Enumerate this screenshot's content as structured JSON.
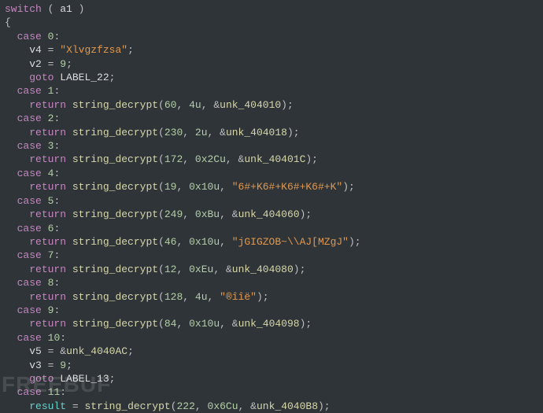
{
  "code": {
    "switch_kw": "switch",
    "switch_var": "a1",
    "case0": {
      "label": "case",
      "num": "0",
      "v4": "v4",
      "v4_val": "\"Xlvgzfzsa\"",
      "v2": "v2",
      "v2_val": "9",
      "goto_kw": "goto",
      "goto_target": "LABEL_22"
    },
    "case1": {
      "label": "case",
      "num": "1",
      "ret": "return",
      "fn": "string_decrypt",
      "a": "60",
      "b": "4u",
      "amp": "&",
      "c": "unk_404010"
    },
    "case2": {
      "label": "case",
      "num": "2",
      "ret": "return",
      "fn": "string_decrypt",
      "a": "230",
      "b": "2u",
      "amp": "&",
      "c": "unk_404018"
    },
    "case3": {
      "label": "case",
      "num": "3",
      "ret": "return",
      "fn": "string_decrypt",
      "a": "172",
      "b": "0x2Cu",
      "amp": "&",
      "c": "unk_40401C"
    },
    "case4": {
      "label": "case",
      "num": "4",
      "ret": "return",
      "fn": "string_decrypt",
      "a": "19",
      "b": "0x10u",
      "c": "\"6#+K6#+K6#+K6#+K\""
    },
    "case5": {
      "label": "case",
      "num": "5",
      "ret": "return",
      "fn": "string_decrypt",
      "a": "249",
      "b": "0xBu",
      "amp": "&",
      "c": "unk_404060"
    },
    "case6": {
      "label": "case",
      "num": "6",
      "ret": "return",
      "fn": "string_decrypt",
      "a": "46",
      "b": "0x10u",
      "c": "\"jGIGZOB~\\\\AJ[MZgJ\""
    },
    "case7": {
      "label": "case",
      "num": "7",
      "ret": "return",
      "fn": "string_decrypt",
      "a": "12",
      "b": "0xEu",
      "amp": "&",
      "c": "unk_404080"
    },
    "case8": {
      "label": "case",
      "num": "8",
      "ret": "return",
      "fn": "string_decrypt",
      "a": "128",
      "b": "4u",
      "c": "\"®îîë\""
    },
    "case9": {
      "label": "case",
      "num": "9",
      "ret": "return",
      "fn": "string_decrypt",
      "a": "84",
      "b": "0x10u",
      "amp": "&",
      "c": "unk_404098"
    },
    "case10": {
      "label": "case",
      "num": "10",
      "v5": "v5",
      "v5_amp": "&",
      "v5_val": "unk_4040AC",
      "v3": "v3",
      "v3_val": "9",
      "goto_kw": "goto",
      "goto_target": "LABEL_13"
    },
    "case11": {
      "label": "case",
      "num": "11",
      "res": "result",
      "fn": "string_decrypt",
      "a": "222",
      "b": "0x6Cu",
      "amp": "&",
      "c": "unk_4040B8"
    }
  },
  "watermark": "FREEBUF"
}
